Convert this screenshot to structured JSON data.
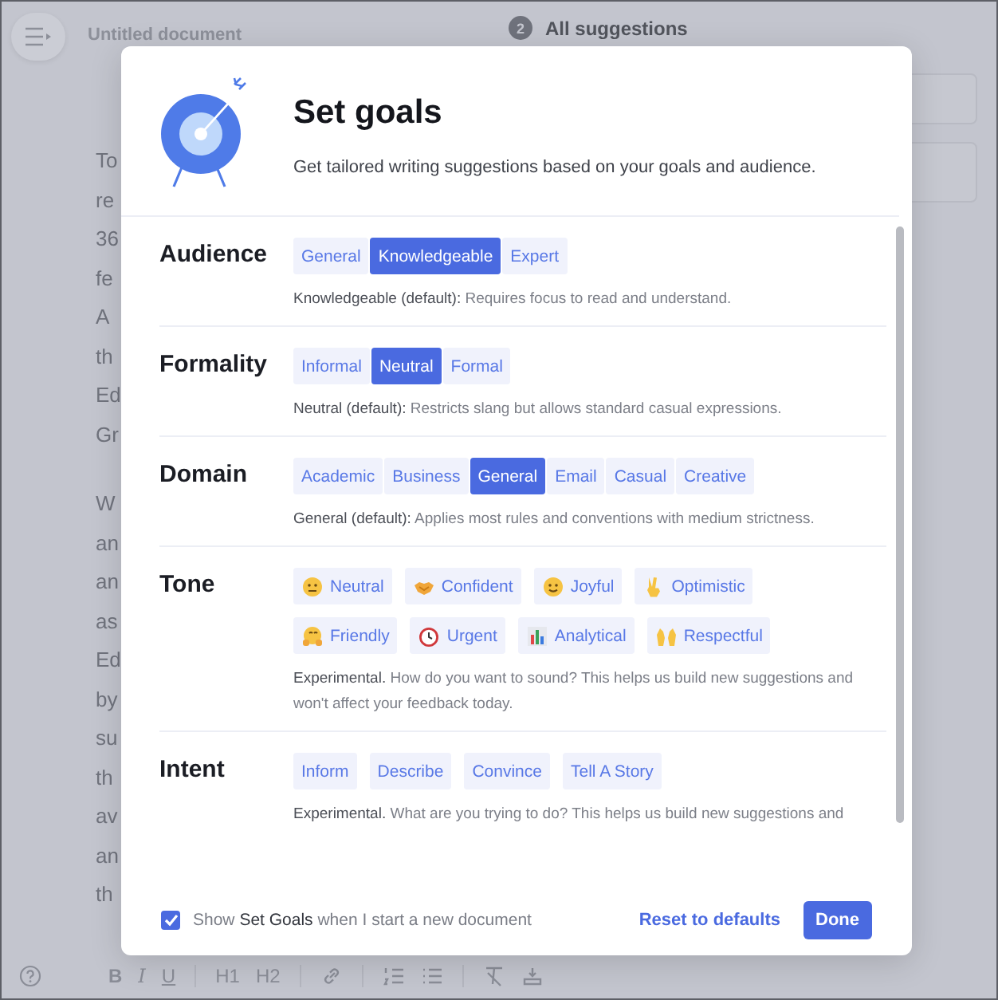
{
  "editor": {
    "title": "Untitled document",
    "suggestions_count": "2",
    "suggestions_label": "All suggestions",
    "paragraphs": [
      [
        "To",
        "re",
        "36",
        "fe",
        "A",
        "th",
        "Ed",
        "Gr"
      ],
      [
        "W",
        "an",
        "an",
        "as",
        "Ed",
        "by",
        "su",
        "th",
        "av",
        "an",
        "th"
      ]
    ],
    "format_buttons": [
      "B",
      "I",
      "U",
      "H1",
      "H2"
    ]
  },
  "dialog": {
    "title": "Set goals",
    "subtitle": "Get tailored writing suggestions based on your goals and audience.",
    "sections": [
      {
        "label": "Audience",
        "kind": "segmented",
        "options": [
          {
            "label": "General",
            "selected": false
          },
          {
            "label": "Knowledgeable",
            "selected": true
          },
          {
            "label": "Expert",
            "selected": false
          }
        ],
        "description": "**Knowledgeable (default):** Requires focus to read and understand."
      },
      {
        "label": "Formality",
        "kind": "segmented",
        "options": [
          {
            "label": "Informal",
            "selected": false
          },
          {
            "label": "Neutral",
            "selected": true
          },
          {
            "label": "Formal",
            "selected": false
          }
        ],
        "description": "**Neutral (default):** Restricts slang but allows standard casual expressions."
      },
      {
        "label": "Domain",
        "kind": "segmented",
        "options": [
          {
            "label": "Academic",
            "selected": false
          },
          {
            "label": "Business",
            "selected": false
          },
          {
            "label": "General",
            "selected": true
          },
          {
            "label": "Email",
            "selected": false
          },
          {
            "label": "Casual",
            "selected": false
          },
          {
            "label": "Creative",
            "selected": false
          }
        ],
        "description": "**General (default):** Applies most rules and conventions with medium strictness."
      },
      {
        "label": "Tone",
        "kind": "chips",
        "options": [
          {
            "label": "Neutral",
            "selected": false
          },
          {
            "label": "Confident",
            "selected": false
          },
          {
            "label": "Joyful",
            "selected": false
          },
          {
            "label": "Optimistic",
            "selected": false
          },
          {
            "label": "Friendly",
            "selected": false
          },
          {
            "label": "Urgent",
            "selected": false
          },
          {
            "label": "Analytical",
            "selected": false
          },
          {
            "label": "Respectful",
            "selected": false
          }
        ],
        "description": "**Experimental.** How do you want to sound? This helps us build new suggestions and won't affect your feedback today."
      },
      {
        "label": "Intent",
        "kind": "chips",
        "options": [
          {
            "label": "Inform",
            "selected": false
          },
          {
            "label": "Describe",
            "selected": false
          },
          {
            "label": "Convince",
            "selected": false
          },
          {
            "label": "Tell A Story",
            "selected": false
          }
        ],
        "description": "**Experimental.** What are you trying to do? This helps us build new suggestions and"
      }
    ],
    "show_on_new": {
      "checked": true,
      "text": "Show **Set Goals** when I start a new document"
    },
    "reset": "Reset to defaults",
    "done": "Done"
  }
}
